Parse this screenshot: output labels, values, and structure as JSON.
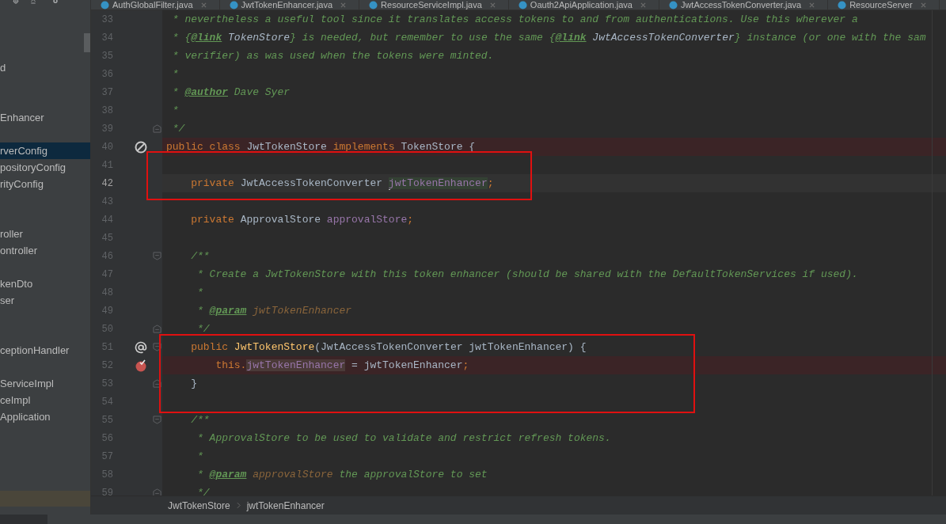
{
  "tabs": [
    {
      "label": "AuthGlobalFilter.java"
    },
    {
      "label": "JwtTokenEnhancer.java"
    },
    {
      "label": "ResourceServiceImpl.java"
    },
    {
      "label": "Oauth2ApiApplication.java"
    },
    {
      "label": "JwtAccessTokenConverter.java"
    },
    {
      "label": "ResourceServer"
    }
  ],
  "project_tree": {
    "items": [
      {
        "label": "d",
        "selected": false
      },
      {
        "label": "Enhancer",
        "selected": false
      },
      {
        "label": "rverConfig",
        "selected": true
      },
      {
        "label": "positoryConfig",
        "selected": false
      },
      {
        "label": "rityConfig",
        "selected": false
      },
      {
        "label": "roller",
        "selected": false
      },
      {
        "label": "ontroller",
        "selected": false
      },
      {
        "label": "kenDto",
        "selected": false
      },
      {
        "label": "ser",
        "selected": false
      },
      {
        "label": "ceptionHandler",
        "selected": false
      },
      {
        "label": "ServiceImpl",
        "selected": false
      },
      {
        "label": "ceImpl",
        "selected": false
      },
      {
        "label": "Application",
        "selected": false
      }
    ]
  },
  "editor": {
    "lines": [
      {
        "number": "33",
        "tokens": [
          {
            "kind": "comment",
            "text": " * nevertheless a useful tool since it translates access tokens to and from authentications. Use this wherever a"
          }
        ]
      },
      {
        "number": "34",
        "tokens": [
          {
            "kind": "comment",
            "text": " * {"
          },
          {
            "kind": "tag",
            "text": "@link"
          },
          {
            "kind": "docref",
            "text": " TokenStore"
          },
          {
            "kind": "comment",
            "text": "} is needed, but remember to use the same {"
          },
          {
            "kind": "tag",
            "text": "@link"
          },
          {
            "kind": "docref",
            "text": " JwtAccessTokenConverter"
          },
          {
            "kind": "comment",
            "text": "} instance (or one with the sam"
          }
        ]
      },
      {
        "number": "35",
        "tokens": [
          {
            "kind": "comment",
            "text": " * verifier) as was used when the tokens were minted."
          }
        ]
      },
      {
        "number": "36",
        "tokens": [
          {
            "kind": "comment",
            "text": " *"
          }
        ]
      },
      {
        "number": "37",
        "tokens": [
          {
            "kind": "comment",
            "text": " * "
          },
          {
            "kind": "tag",
            "text": "@author"
          },
          {
            "kind": "comment",
            "text": " Dave Syer"
          }
        ]
      },
      {
        "number": "38",
        "tokens": [
          {
            "kind": "comment",
            "text": " *"
          }
        ]
      },
      {
        "number": "39",
        "fold_end": true,
        "tokens": [
          {
            "kind": "comment",
            "text": " */"
          }
        ]
      },
      {
        "number": "40",
        "no_entry": true,
        "error_line": true,
        "tokens": [
          {
            "kind": "keyword",
            "text": "public class "
          },
          {
            "kind": "plain",
            "text": "JwtTokenStore "
          },
          {
            "kind": "keyword",
            "text": "implements "
          },
          {
            "kind": "plain",
            "text": "TokenStore {"
          }
        ]
      },
      {
        "number": "41"
      },
      {
        "number": "42",
        "current_line": true,
        "boxed": true,
        "tokens": [
          {
            "kind": "keyword",
            "text": "    private "
          },
          {
            "kind": "plain",
            "text": "JwtAccessTokenConverter "
          },
          {
            "kind": "field",
            "text": "jwtTokenEnhancer",
            "caret": true,
            "usage": true
          },
          {
            "kind": "keyword",
            "text": ";"
          }
        ]
      },
      {
        "number": "43"
      },
      {
        "number": "44",
        "tokens": [
          {
            "kind": "keyword",
            "text": "    private "
          },
          {
            "kind": "plain",
            "text": "ApprovalStore "
          },
          {
            "kind": "field",
            "text": "approvalStore"
          },
          {
            "kind": "keyword",
            "text": ";"
          }
        ]
      },
      {
        "number": "45"
      },
      {
        "number": "46",
        "fold_start": true,
        "tokens": [
          {
            "kind": "comment",
            "text": "    /**"
          }
        ]
      },
      {
        "number": "47",
        "tokens": [
          {
            "kind": "comment",
            "text": "     * Create a JwtTokenStore with this token enhancer (should be shared with the DefaultTokenServices if used)."
          }
        ]
      },
      {
        "number": "48",
        "tokens": [
          {
            "kind": "comment",
            "text": "     *"
          }
        ]
      },
      {
        "number": "49",
        "tokens": [
          {
            "kind": "comment",
            "text": "     * "
          },
          {
            "kind": "tag",
            "text": "@param"
          },
          {
            "kind": "docparam",
            "text": " jwtTokenEnhancer"
          }
        ]
      },
      {
        "number": "50",
        "fold_end": true,
        "tokens": [
          {
            "kind": "comment",
            "text": "     */"
          }
        ]
      },
      {
        "number": "51",
        "override": true,
        "fold_start": true,
        "boxed": true,
        "tokens": [
          {
            "kind": "keyword",
            "text": "    public "
          },
          {
            "kind": "method",
            "text": "JwtTokenStore"
          },
          {
            "kind": "plain",
            "text": "(JwtAccessTokenConverter jwtTokenEnhancer) {"
          }
        ]
      },
      {
        "number": "52",
        "breakpoint": true,
        "error_line": true,
        "boxed": true,
        "tokens": [
          {
            "kind": "keyword",
            "text": "        this."
          },
          {
            "kind": "field",
            "text": "jwtTokenEnhancer",
            "usage": true
          },
          {
            "kind": "plain",
            "text": " = jwtTokenEnhancer"
          },
          {
            "kind": "keyword",
            "text": ";"
          }
        ]
      },
      {
        "number": "53",
        "fold_end": true,
        "boxed": true,
        "tokens": [
          {
            "kind": "plain",
            "text": "    }"
          }
        ]
      },
      {
        "number": "54",
        "boxed": true
      },
      {
        "number": "55",
        "fold_start": true,
        "tokens": [
          {
            "kind": "comment",
            "text": "    /**"
          }
        ]
      },
      {
        "number": "56",
        "tokens": [
          {
            "kind": "comment",
            "text": "     * ApprovalStore to be used to validate and restrict refresh tokens."
          }
        ]
      },
      {
        "number": "57",
        "tokens": [
          {
            "kind": "comment",
            "text": "     *"
          }
        ]
      },
      {
        "number": "58",
        "tokens": [
          {
            "kind": "comment",
            "text": "     * "
          },
          {
            "kind": "tag",
            "text": "@param"
          },
          {
            "kind": "docparam",
            "text": " approvalStore"
          },
          {
            "kind": "comment",
            "text": " the approvalStore to set"
          }
        ]
      },
      {
        "number": "59",
        "fold_end": true,
        "tokens": [
          {
            "kind": "comment",
            "text": "     */"
          }
        ]
      }
    ]
  },
  "breadcrumb": [
    "JwtTokenStore",
    "jwtTokenEnhancer"
  ]
}
